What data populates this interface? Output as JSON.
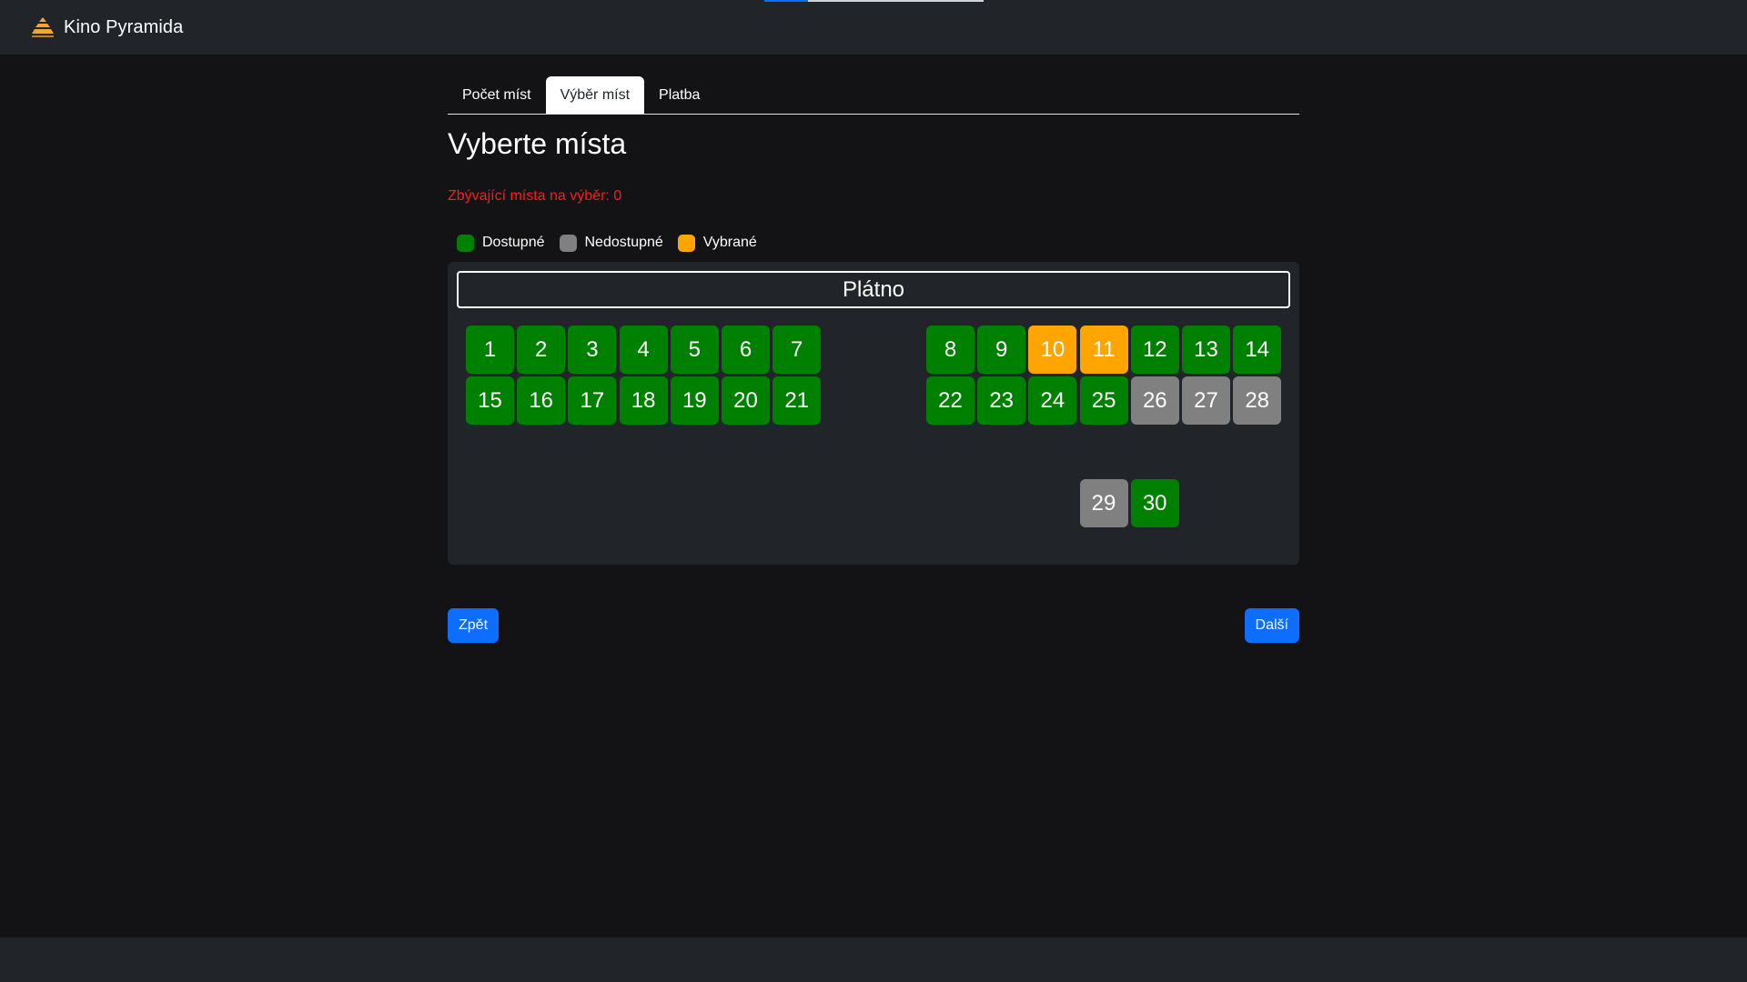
{
  "app": {
    "brand": "Kino Pyramida",
    "progress": 0.2
  },
  "tabs": [
    {
      "label": "Počet míst",
      "active": false
    },
    {
      "label": "Výběr míst",
      "active": true
    },
    {
      "label": "Platba",
      "active": false
    }
  ],
  "page": {
    "title": "Vyberte místa",
    "remaining_text": "Zbývající místa na výběr: 0"
  },
  "legend": [
    {
      "label": "Dostupné",
      "status": "available"
    },
    {
      "label": "Nedostupné",
      "status": "unavailable"
    },
    {
      "label": "Vybrané",
      "status": "selected"
    }
  ],
  "colors": {
    "available": "#008000",
    "unavailable": "#808080",
    "selected": "#ffa500",
    "primary": "#0d6efd",
    "warning_text": "#ff1a1a"
  },
  "hall": {
    "screen_label": "Plátno",
    "seats": [
      {
        "number": "1",
        "status": "available"
      },
      {
        "number": "2",
        "status": "available"
      },
      {
        "number": "3",
        "status": "available"
      },
      {
        "number": "4",
        "status": "available"
      },
      {
        "number": "5",
        "status": "available"
      },
      {
        "number": "6",
        "status": "available"
      },
      {
        "number": "7",
        "status": "available"
      },
      {
        "number": "8",
        "status": "available"
      },
      {
        "number": "9",
        "status": "available"
      },
      {
        "number": "10",
        "status": "selected"
      },
      {
        "number": "11",
        "status": "selected"
      },
      {
        "number": "12",
        "status": "available"
      },
      {
        "number": "13",
        "status": "available"
      },
      {
        "number": "14",
        "status": "available"
      },
      {
        "number": "15",
        "status": "available"
      },
      {
        "number": "16",
        "status": "available"
      },
      {
        "number": "17",
        "status": "available"
      },
      {
        "number": "18",
        "status": "available"
      },
      {
        "number": "19",
        "status": "available"
      },
      {
        "number": "20",
        "status": "available"
      },
      {
        "number": "21",
        "status": "available"
      },
      {
        "number": "22",
        "status": "available"
      },
      {
        "number": "23",
        "status": "available"
      },
      {
        "number": "24",
        "status": "available"
      },
      {
        "number": "25",
        "status": "available"
      },
      {
        "number": "26",
        "status": "unavailable"
      },
      {
        "number": "27",
        "status": "unavailable"
      },
      {
        "number": "28",
        "status": "unavailable"
      },
      {
        "number": "29",
        "status": "unavailable"
      },
      {
        "number": "30",
        "status": "available"
      }
    ]
  },
  "buttons": {
    "back": "Zpět",
    "next": "Další"
  }
}
